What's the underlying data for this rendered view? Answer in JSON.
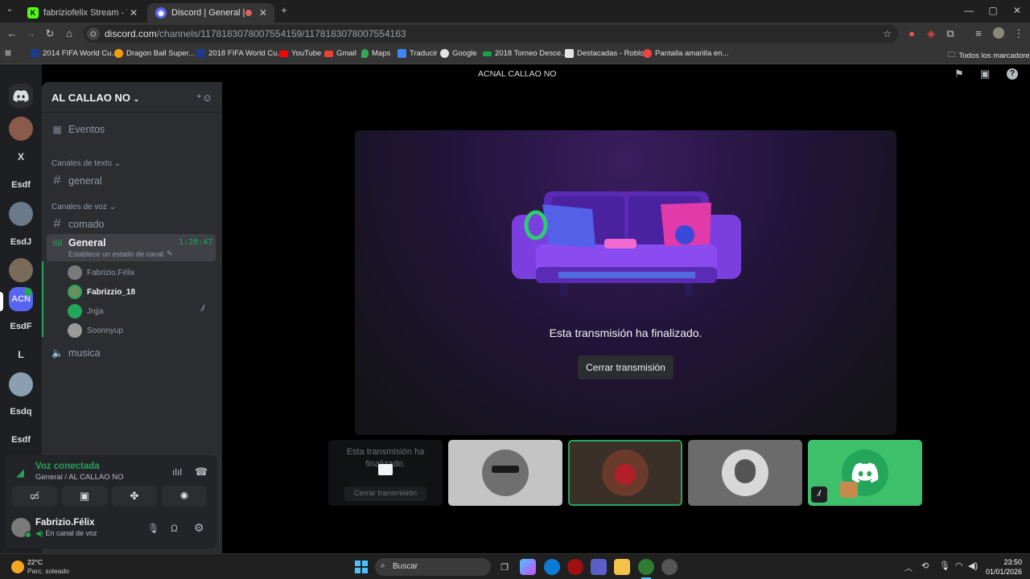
{
  "browser": {
    "tabs": [
      {
        "title": "fabriziofelix Stream - Watch Liv...",
        "favicon": "K",
        "favicon_color": "#53fc18"
      },
      {
        "title": "Discord | General | AL CALL...",
        "favicon": "D",
        "favicon_color": "#5865f2"
      }
    ],
    "new_tab": "+",
    "url_host": "discord.com",
    "url_path": "/channels/1178183078007554159/1178183078007554163",
    "bookmarks": [
      {
        "label": "2014 FIFA World Cu...",
        "color": "#1e3a8a"
      },
      {
        "label": "Dragon Ball Super...",
        "color": "#f59e0b"
      },
      {
        "label": "2018 FIFA World Cu...",
        "color": "#1e3a8a"
      },
      {
        "label": "YouTube",
        "color": "#ff0000"
      },
      {
        "label": "Gmail",
        "color": "#ea4335"
      },
      {
        "label": "Maps",
        "color": "#34a853"
      },
      {
        "label": "Traducir",
        "color": "#4285f4"
      },
      {
        "label": "Google",
        "color": "#e3e3e3"
      },
      {
        "label": "2018 Torneo Desce...",
        "color": "#16a34a"
      },
      {
        "label": "Destacadas - Roblox",
        "color": "#e3e3e3"
      },
      {
        "label": "Pantalla amarilla en...",
        "color": "#ef4444"
      }
    ],
    "all_bookmarks": "Todos los marcadores"
  },
  "guilds": [
    {
      "label": "",
      "color": "#5865f2",
      "type": "home"
    },
    {
      "label": "",
      "color": "#8a5a4a",
      "type": "avatar"
    },
    {
      "label": "X",
      "color": "#2b2d31"
    },
    {
      "label": "Esdf",
      "color": "#2b2d31"
    },
    {
      "label": "",
      "color": "#6a7a8a",
      "type": "avatar"
    },
    {
      "label": "EsdJ",
      "color": "#2b2d31"
    },
    {
      "label": "",
      "color": "#7a6a5a",
      "type": "avatar"
    },
    {
      "label": "ACN",
      "color": "#5865f2"
    },
    {
      "label": "EsdF",
      "color": "#2b2d31"
    },
    {
      "label": "L",
      "color": "#2b2d31"
    },
    {
      "label": "",
      "color": "#8aa0b0",
      "type": "avatar"
    },
    {
      "label": "Esdq",
      "color": "#2b2d31"
    },
    {
      "label": "Esdf",
      "color": "#2b2d31"
    }
  ],
  "server": {
    "name": "AL CALLAO NO",
    "events": "Eventos",
    "text_category": "Canales de texto",
    "text_channels": [
      "general"
    ],
    "voice_category": "Canales de voz",
    "voice_channels": [
      {
        "name": "comado"
      },
      {
        "name": "General",
        "timer": "1:20:47",
        "status": "Establece un estado de canal"
      }
    ],
    "voice_users": [
      {
        "name": "Fabrizio.Félix",
        "color": "#7a7a7a",
        "bold": false
      },
      {
        "name": "Fabrizzio_18",
        "color": "#6b8e5a",
        "bold": true
      },
      {
        "name": "Jnjja",
        "color": "#23a55a",
        "bold": false
      },
      {
        "name": "Soonnyup",
        "color": "#9a9a9a",
        "bold": false
      }
    ],
    "extra_channel": "musica"
  },
  "topbar": {
    "acronym": "ACN",
    "title": "AL CALLAO NO"
  },
  "stream": {
    "ended_text": "Esta transmisión ha finalizado.",
    "close_button": "Cerrar transmisión",
    "mini_ended": "Esta transmisión ha finalizado.",
    "mini_close": "Cerrar transmisión"
  },
  "user_panel": {
    "voice_status": "Voz conectada",
    "voice_location": "General / AL CALLAO NO",
    "username": "Fabrizio.Félix",
    "substatus": "En canal de voz"
  },
  "taskbar": {
    "weather_temp": "22°C",
    "weather_desc": "Parc. soleado",
    "search": "Buscar",
    "time": "23:50",
    "date": "01/01/2026"
  },
  "colors": {
    "discord_green": "#23a55a",
    "blurple": "#5865f2"
  }
}
